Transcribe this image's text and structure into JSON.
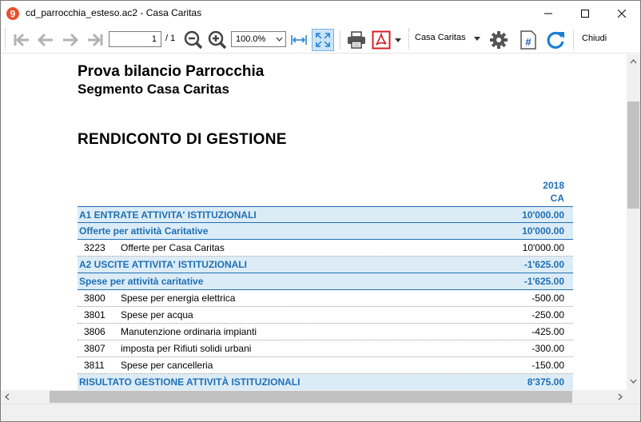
{
  "window": {
    "title": "cd_parrocchia_esteso.ac2 - Casa Caritas"
  },
  "toolbar": {
    "page_current": "1",
    "page_total": "/ 1",
    "zoom": "100.0%",
    "segment": "Casa Caritas",
    "close_label": "Chiudi"
  },
  "document": {
    "title": "Prova bilancio Parrocchia",
    "subtitle": "Segmento Casa Caritas",
    "heading": "RENDICONTO DI GESTIONE",
    "column_year": "2018",
    "column_segment": "CA",
    "rows": [
      {
        "type": "group",
        "label": "A1 ENTRATE ATTIVITA' ISTITUZIONALI",
        "amount": "10'000.00"
      },
      {
        "type": "group",
        "label": "Offerte per attività Caritative",
        "amount": "10'000.00"
      },
      {
        "type": "item",
        "code": "3223",
        "label": "Offerte per Casa Caritas",
        "amount": "10'000.00"
      },
      {
        "type": "group",
        "label": "A2 USCITE ATTIVITA' ISTITUZIONALI",
        "amount": "-1'625.00"
      },
      {
        "type": "group",
        "label": "Spese per attività caritative",
        "amount": "-1'625.00"
      },
      {
        "type": "item",
        "code": "3800",
        "label": "Spese per energia elettrica",
        "amount": "-500.00"
      },
      {
        "type": "item",
        "code": "3801",
        "label": "Spese per acqua",
        "amount": "-250.00"
      },
      {
        "type": "item",
        "code": "3806",
        "label": "Manutenzione ordinaria impianti",
        "amount": "-425.00"
      },
      {
        "type": "item",
        "code": "3807",
        "label": "imposta per Rifiuti solidi urbani",
        "amount": "-300.00"
      },
      {
        "type": "item",
        "code": "3811",
        "label": "Spese per cancelleria",
        "amount": "-150.00"
      },
      {
        "type": "group",
        "label": "RISULTATO GESTIONE ATTIVITÀ ISTITUZIONALI",
        "amount": "8'375.00"
      }
    ]
  },
  "colors": {
    "accent_blue": "#1f6fb5",
    "group_row_bg": "#dcecf7",
    "pdf_red": "#d42020",
    "refresh_blue": "#1a7fd4"
  }
}
